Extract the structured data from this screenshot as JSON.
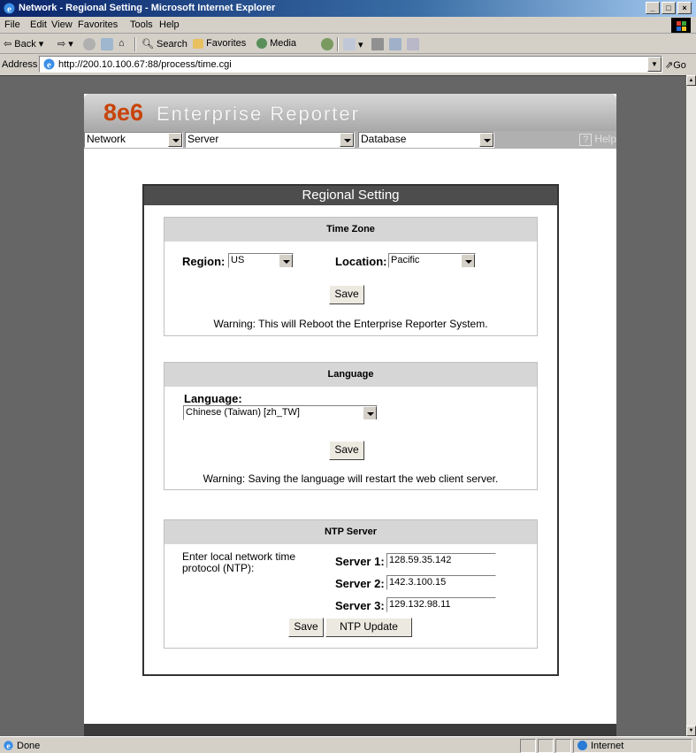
{
  "window": {
    "title": "Network - Regional Setting - Microsoft Internet Explorer"
  },
  "menu": [
    "File",
    "Edit",
    "View",
    "Favorites",
    "Tools",
    "Help"
  ],
  "toolbar": {
    "back": "Back",
    "search": "Search",
    "favorites": "Favorites",
    "media": "Media"
  },
  "address": {
    "label": "Address",
    "url": "http://200.10.100.67:88/process/time.cgi",
    "go": "Go"
  },
  "app": {
    "brand": "8e6",
    "product": "Enterprise Reporter",
    "nav": {
      "network": "Network",
      "server": "Server",
      "database": "Database",
      "help": "Help"
    }
  },
  "panel": {
    "title": "Regional Setting",
    "timezone": {
      "heading": "Time Zone",
      "region_label": "Region:",
      "region_value": "US",
      "location_label": "Location:",
      "location_value": "Pacific",
      "save": "Save",
      "warning": "Warning: This will Reboot the Enterprise Reporter System."
    },
    "language": {
      "heading": "Language",
      "label": "Language:",
      "value": "Chinese (Taiwan) [zh_TW]",
      "save": "Save",
      "warning": "Warning: Saving the language will restart the web client server."
    },
    "ntp": {
      "heading": "NTP Server",
      "description": "Enter local network time protocol (NTP):",
      "server1_label": "Server 1:",
      "server1_value": "128.59.35.142",
      "server2_label": "Server 2:",
      "server2_value": "142.3.100.15",
      "server3_label": "Server 3:",
      "server3_value": "129.132.98.11",
      "save": "Save",
      "update": "NTP Update"
    }
  },
  "status": {
    "text": "Done",
    "zone": "Internet"
  },
  "colors": {
    "brand": "#c8440a",
    "title_bar": "#0a246a",
    "page_bg": "#666666",
    "panel_head": "#4d4d4d"
  }
}
